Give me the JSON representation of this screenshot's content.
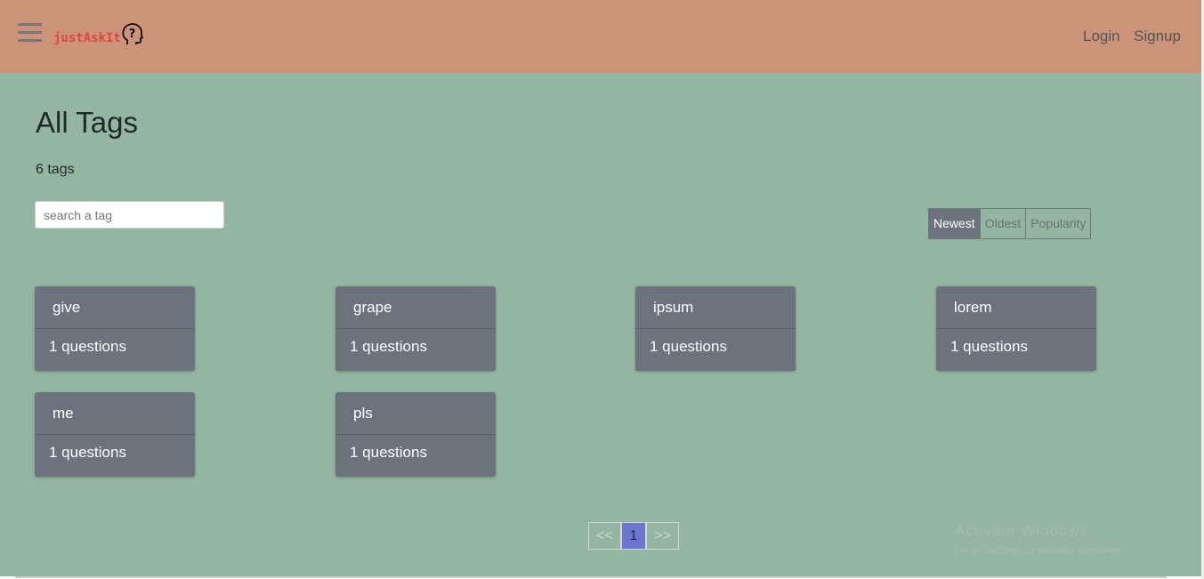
{
  "app": {
    "brand_text": "justAskIt"
  },
  "nav": {
    "login_label": "Login",
    "signup_label": "Signup"
  },
  "page": {
    "title": "All Tags",
    "tag_count": "6 tags"
  },
  "search": {
    "placeholder": "search a tag",
    "value": ""
  },
  "sort": {
    "newest": "Newest",
    "oldest": "Oldest",
    "popularity": "Popularity",
    "selected": "Newest"
  },
  "tags": [
    {
      "name": "give",
      "questions": "1 questions"
    },
    {
      "name": "grape",
      "questions": "1 questions"
    },
    {
      "name": "ipsum",
      "questions": "1 questions"
    },
    {
      "name": "lorem",
      "questions": "1 questions"
    },
    {
      "name": "me",
      "questions": "1 questions"
    },
    {
      "name": "pls",
      "questions": "1 questions"
    }
  ],
  "pagination": {
    "prev": "<<",
    "current": "1",
    "next": ">>"
  },
  "watermark": {
    "line1": "Activate Windows",
    "line2": "Go to Settings to activate Windows."
  },
  "colors": {
    "navbar": "#cb9479",
    "background": "#93b5a2",
    "card": "#6c737d",
    "brand": "#e0453f",
    "page_active": "#6c76d0"
  }
}
